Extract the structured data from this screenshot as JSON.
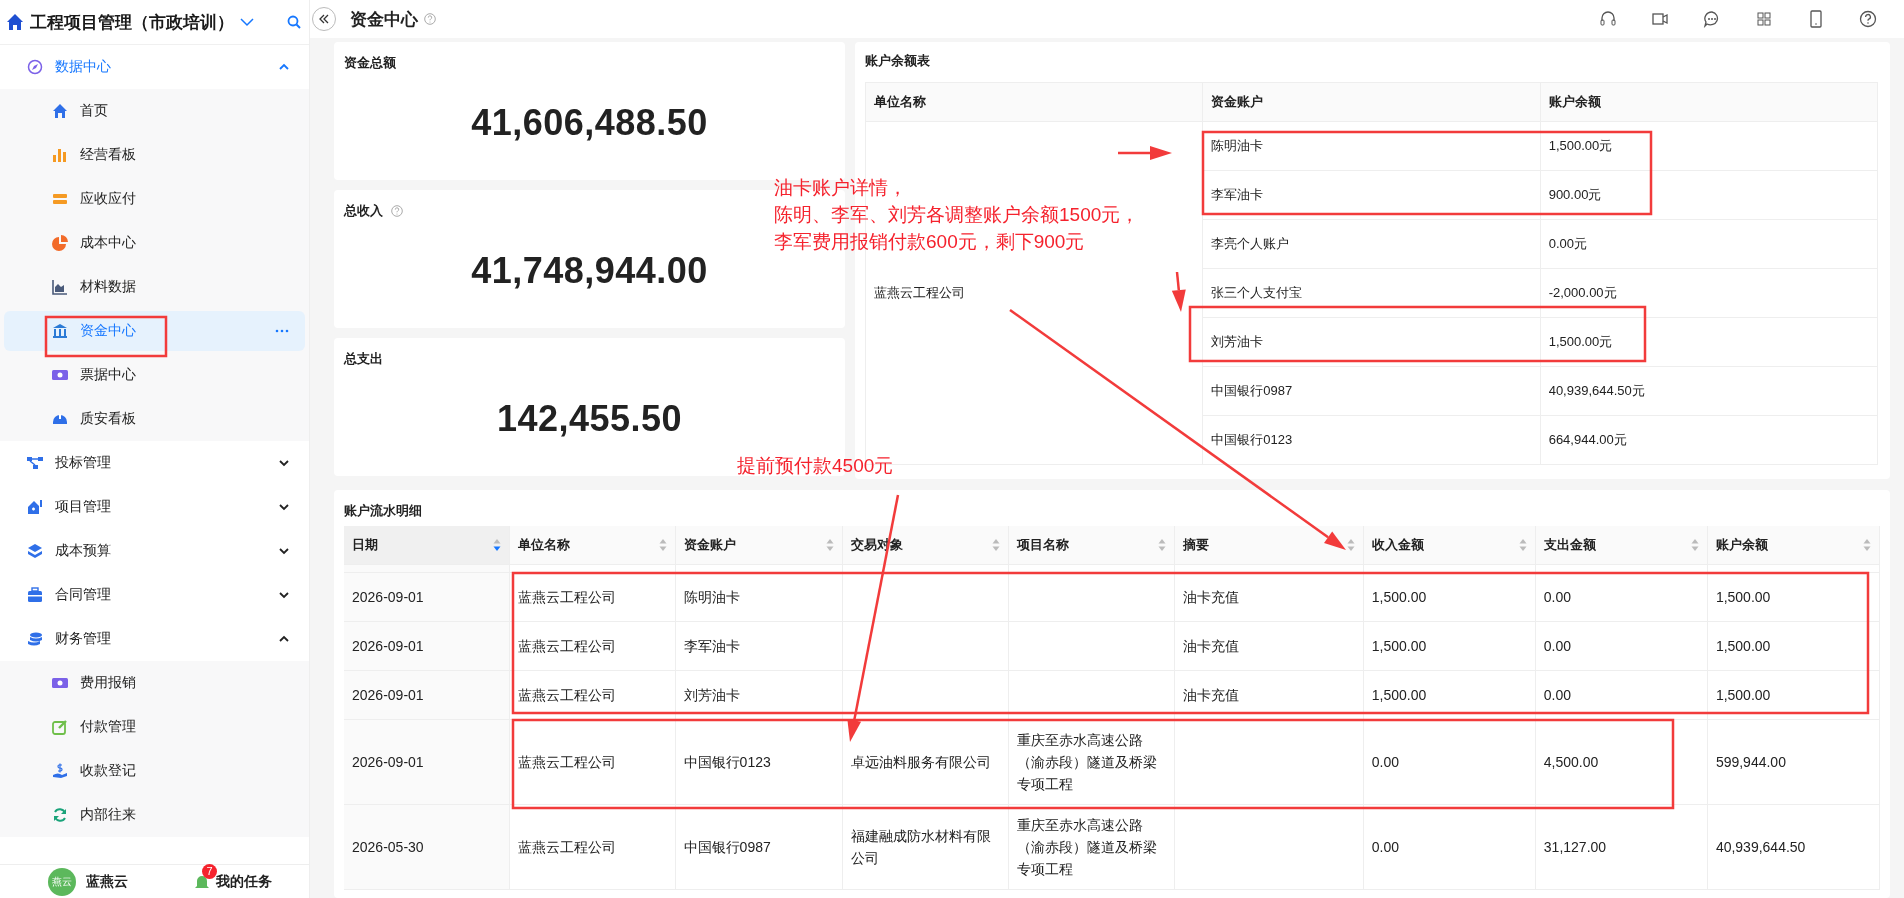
{
  "app": {
    "title": "工程项目管理（市政培训）"
  },
  "sidebar": {
    "groups": [
      {
        "label": "数据中心",
        "expanded": true,
        "items": [
          {
            "label": "首页",
            "selected": false
          },
          {
            "label": "经营看板",
            "selected": false
          },
          {
            "label": "应收应付",
            "selected": false
          },
          {
            "label": "成本中心",
            "selected": false
          },
          {
            "label": "材料数据",
            "selected": false
          },
          {
            "label": "资金中心",
            "selected": true
          },
          {
            "label": "票据中心",
            "selected": false
          },
          {
            "label": "质安看板",
            "selected": false
          }
        ]
      },
      {
        "label": "投标管理",
        "expanded": false
      },
      {
        "label": "项目管理",
        "expanded": false
      },
      {
        "label": "成本预算",
        "expanded": false
      },
      {
        "label": "合同管理",
        "expanded": false
      },
      {
        "label": "财务管理",
        "expanded": true,
        "items": [
          {
            "label": "费用报销",
            "selected": false
          },
          {
            "label": "付款管理",
            "selected": false
          },
          {
            "label": "收款登记",
            "selected": false
          },
          {
            "label": "内部往来",
            "selected": false
          }
        ]
      }
    ],
    "footer": {
      "avatar_text": "燕云",
      "user": "蓝燕云",
      "tasks": "我的任务",
      "tasks_badge": "7"
    }
  },
  "page": {
    "title": "资金中心"
  },
  "stats": [
    {
      "label": "资金总额",
      "help": false,
      "value": "41,606,488.50"
    },
    {
      "label": "总收入",
      "help": true,
      "value": "41,748,944.00"
    },
    {
      "label": "总支出",
      "help": false,
      "value": "142,455.50"
    }
  ],
  "balance_table": {
    "title": "账户余额表",
    "columns": [
      "单位名称",
      "资金账户",
      "账户余额"
    ],
    "unit": "蓝燕云工程公司",
    "rows": [
      {
        "account": "陈明油卡",
        "balance": "1,500.00元"
      },
      {
        "account": "李军油卡",
        "balance": "900.00元"
      },
      {
        "account": "李亮个人账户",
        "balance": "0.00元"
      },
      {
        "account": "张三个人支付宝",
        "balance": "-2,000.00元"
      },
      {
        "account": "刘芳油卡",
        "balance": "1,500.00元"
      },
      {
        "account": "中国银行0987",
        "balance": "40,939,644.50元"
      },
      {
        "account": "中国银行0123",
        "balance": "664,944.00元"
      }
    ]
  },
  "ledger": {
    "title": "账户流水明细",
    "columns": [
      {
        "label": "日期",
        "sorted": true
      },
      {
        "label": "单位名称",
        "sorted": false
      },
      {
        "label": "资金账户",
        "sorted": false
      },
      {
        "label": "交易对象",
        "sorted": false
      },
      {
        "label": "项目名称",
        "sorted": false
      },
      {
        "label": "摘要",
        "sorted": false
      },
      {
        "label": "收入金额",
        "sorted": false
      },
      {
        "label": "支出金额",
        "sorted": false
      },
      {
        "label": "账户余额",
        "sorted": false
      }
    ],
    "rows": [
      {
        "date": "2026-09-01",
        "unit": "蓝燕云工程公司",
        "account": "陈明油卡",
        "summary": "油卡充值",
        "income": "1,500.00",
        "expense": "0.00",
        "balance": "1,500.00"
      },
      {
        "date": "2026-09-01",
        "unit": "蓝燕云工程公司",
        "account": "李军油卡",
        "summary": "油卡充值",
        "income": "1,500.00",
        "expense": "0.00",
        "balance": "1,500.00"
      },
      {
        "date": "2026-09-01",
        "unit": "蓝燕云工程公司",
        "account": "刘芳油卡",
        "summary": "油卡充值",
        "income": "1,500.00",
        "expense": "0.00",
        "balance": "1,500.00"
      },
      {
        "date": "2026-09-01",
        "unit": "蓝燕云工程公司",
        "account": "中国银行0123",
        "counterparty": "卓远油料服务有限公司",
        "project": "重庆至赤水高速公路（渝赤段）隧道及桥梁专项工程",
        "income": "0.00",
        "expense": "4,500.00",
        "balance": "599,944.00"
      },
      {
        "date": "2026-05-30",
        "unit": "蓝燕云工程公司",
        "account": "中国银行0987",
        "counterparty": "福建融成防水材料有限公司",
        "project": "重庆至赤水高速公路（渝赤段）隧道及桥梁专项工程",
        "income": "0.00",
        "expense": "31,127.00",
        "balance": "40,939,644.50"
      }
    ]
  },
  "annotations": {
    "notes": [
      "油卡账户详情，",
      "陈明、李军、刘芳各调整账户余额1500元，",
      "李军费用报销付款600元，剩下900元",
      "提前预付款4500元"
    ]
  }
}
